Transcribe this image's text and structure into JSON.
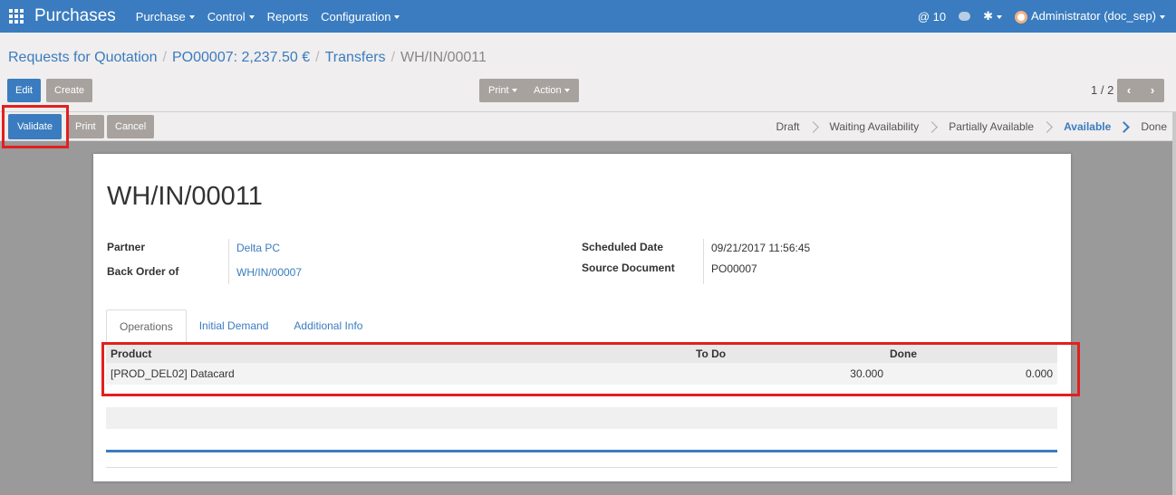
{
  "navbar": {
    "brand": "Purchases",
    "menus": [
      {
        "label": "Purchase",
        "dropdown": true
      },
      {
        "label": "Control",
        "dropdown": true
      },
      {
        "label": "Reports",
        "dropdown": false
      },
      {
        "label": "Configuration",
        "dropdown": true
      }
    ],
    "mentions": "@ 10",
    "user": "Administrator (doc_sep)",
    "color": "#3a7cbf"
  },
  "breadcrumb": {
    "items": [
      "Requests for Quotation",
      "PO00007: 2,237.50 €",
      "Transfers"
    ],
    "current": "WH/IN/00011",
    "separator": "/"
  },
  "toolbar": {
    "edit_label": "Edit",
    "create_label": "Create",
    "print_label": "Print",
    "action_label": "Action",
    "pager": "1 / 2"
  },
  "statusbar": {
    "validate_label": "Validate",
    "print_label": "Print",
    "cancel_label": "Cancel",
    "stages": [
      {
        "label": "Draft",
        "active": false
      },
      {
        "label": "Waiting Availability",
        "active": false
      },
      {
        "label": "Partially Available",
        "active": false
      },
      {
        "label": "Available",
        "active": true
      },
      {
        "label": "Done",
        "active": false
      }
    ]
  },
  "record": {
    "title": "WH/IN/00011",
    "partner_label": "Partner",
    "partner_value": "Delta PC",
    "backorder_label": "Back Order of",
    "backorder_value": "WH/IN/00007",
    "scheduled_label": "Scheduled Date",
    "scheduled_value": "09/21/2017 11:56:45",
    "source_label": "Source Document",
    "source_value": "PO00007"
  },
  "tabs": [
    {
      "label": "Operations",
      "active": true
    },
    {
      "label": "Initial Demand",
      "active": false
    },
    {
      "label": "Additional Info",
      "active": false
    }
  ],
  "table": {
    "headers": {
      "product": "Product",
      "todo": "To Do",
      "done": "Done"
    },
    "rows": [
      {
        "product": "[PROD_DEL02] Datacard",
        "todo": "30.000",
        "done": "0.000"
      }
    ]
  }
}
